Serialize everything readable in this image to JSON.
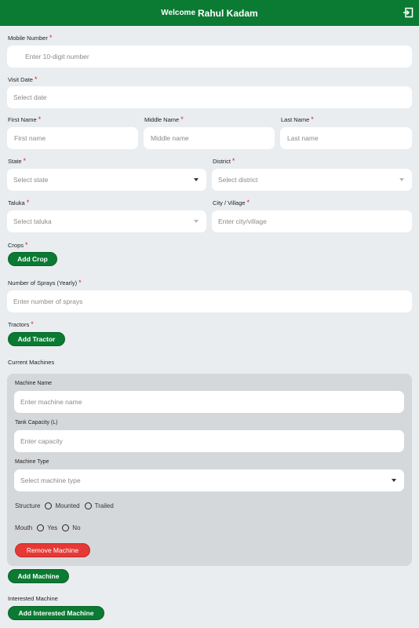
{
  "header": {
    "welcome": "Welcome",
    "user_name": "Rahul Kadam"
  },
  "form": {
    "mobile": {
      "label": "Mobile Number",
      "required": "*",
      "placeholder": "Enter 10-digit number"
    },
    "visit_date": {
      "label": "Visit Date",
      "required": "*",
      "placeholder": "Select date"
    },
    "first_name": {
      "label": "First Name",
      "required": "*",
      "placeholder": "First name"
    },
    "middle_name": {
      "label": "Middle Name",
      "required": "*",
      "placeholder": "Middle name"
    },
    "last_name": {
      "label": "Last Name",
      "required": "*",
      "placeholder": "Last name"
    },
    "state": {
      "label": "State",
      "required": "*",
      "placeholder": "Select state"
    },
    "district": {
      "label": "District",
      "required": "*",
      "placeholder": "Select district"
    },
    "taluka": {
      "label": "Taluka",
      "required": "*",
      "placeholder": "Select taluka"
    },
    "city": {
      "label": "City / Village",
      "required": "*",
      "placeholder": "Enter city/village"
    },
    "crops": {
      "label": "Crops",
      "required": "*",
      "button": "Add Crop"
    },
    "sprays": {
      "label": "Number of Sprays (Yearly)",
      "required": "*",
      "placeholder": "Enter number of sprays"
    },
    "tractors": {
      "label": "Tractors",
      "required": "*",
      "button": "Add Tractor"
    },
    "current_machines": {
      "label": "Current Machines"
    },
    "machine": {
      "name_label": "Machine Name",
      "name_placeholder": "Enter machine name",
      "capacity_label": "Tank Capacity (L)",
      "capacity_placeholder": "Enter capacity",
      "type_label": "Machine Type",
      "type_placeholder": "Select machine type",
      "structure_label": "Structure",
      "structure_options": [
        "Mounted",
        "Trailed"
      ],
      "mouth_label": "Mouth",
      "mouth_options": [
        "Yes",
        "No"
      ],
      "remove_button": "Remove Machine"
    },
    "add_machine_button": "Add Machine",
    "interested_machine": {
      "label": "Interested Machine",
      "button": "Add Interested Machine"
    }
  },
  "colors": {
    "primary": "#0b7a32",
    "danger": "#e53935",
    "background": "#e9edf0",
    "required": "#e02020"
  }
}
